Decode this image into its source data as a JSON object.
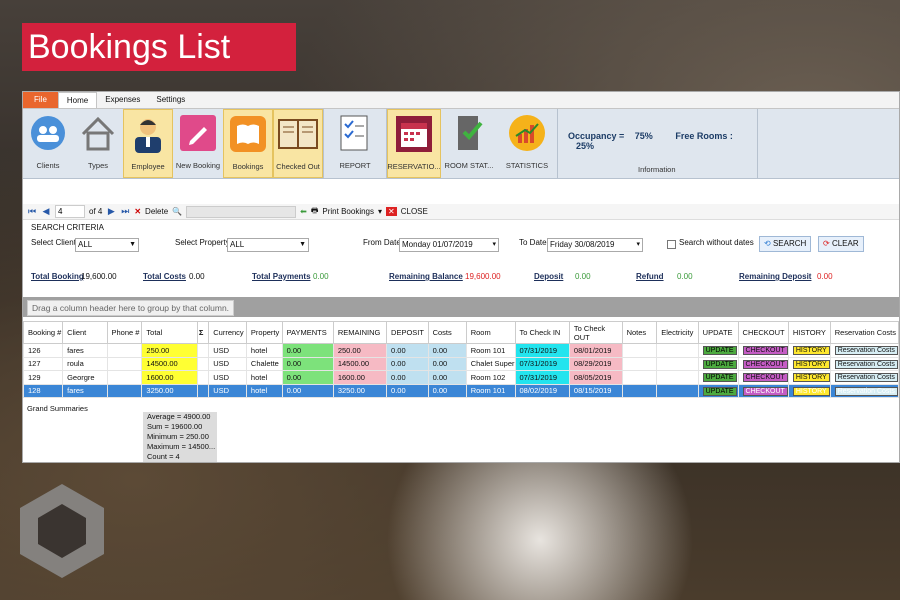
{
  "page_title": "Bookings List",
  "ribbon_tabs": [
    "File",
    "Home",
    "Expenses",
    "Settings"
  ],
  "ribbon_buttons": [
    {
      "label": "Clients",
      "icon": "clients-icon"
    },
    {
      "label": "Types",
      "icon": "home-icon"
    },
    {
      "label": "Employee",
      "icon": "employee-icon"
    },
    {
      "label": "New Booking",
      "icon": "pencil-icon"
    },
    {
      "label": "Bookings",
      "icon": "book-icon"
    },
    {
      "label": "Checked Out",
      "icon": "open-book-icon"
    },
    {
      "label": "REPORT",
      "icon": "report-icon"
    },
    {
      "label": "RESERVATIO...",
      "icon": "calendar-icon"
    },
    {
      "label": "ROOM STAT...",
      "icon": "door-check-icon"
    },
    {
      "label": "STATISTICS",
      "icon": "chart-icon"
    }
  ],
  "info": {
    "occupancy_label": "Occupancy =",
    "occupancy_value": "75%",
    "free_rooms_label": "Free Rooms :",
    "free_rooms_value": "25%",
    "group_label": "Information"
  },
  "navigator": {
    "current": "4",
    "of": "of 4",
    "delete": "Delete",
    "print": "Print Bookings",
    "close": "CLOSE"
  },
  "search": {
    "title": "SEARCH CRITERIA",
    "client_label": "Select Client",
    "client_value": "ALL",
    "property_label": "Select Property",
    "property_value": "ALL",
    "from_label": "From Date:",
    "from_value": "Monday  01/07/2019",
    "to_label": "To Date:",
    "to_value": "Friday  30/08/2019",
    "without_dates": "Search without dates",
    "search_btn": "SEARCH",
    "clear_btn": "CLEAR"
  },
  "totals": {
    "total_booking_label": "Total Booking",
    "total_booking_value": "19,600.00",
    "total_costs_label": "Total Costs",
    "total_costs_value": "0.00",
    "total_payments_label": "Total Payments",
    "total_payments_value": "0.00",
    "remaining_label": "Remaining Balance",
    "remaining_value": "19,600.00",
    "deposit_label": "Deposit",
    "deposit_value": "0.00",
    "refund_label": "Refund",
    "refund_value": "0.00",
    "remaining_deposit_label": "Remaining Deposit",
    "remaining_deposit_value": "0.00"
  },
  "group_hint": "Drag a column header here to group by that column.",
  "columns": [
    "Booking #",
    "Client",
    "Phone #",
    "Total",
    "Σ",
    "Currency",
    "Property",
    "PAYMENTS",
    "REMAINING",
    "DEPOSIT",
    "Costs",
    "Room",
    "To Check IN",
    "To Check OUT",
    "Notes",
    "Electricity",
    "UPDATE",
    "CHECKOUT",
    "HISTORY",
    "Reservation Costs"
  ],
  "rows": [
    {
      "id": "126",
      "client": "fares",
      "phone": "",
      "total": "250.00",
      "currency": "USD",
      "property": "hotel",
      "payments": "0.00",
      "remaining": "250.00",
      "deposit": "0.00",
      "costs": "0.00",
      "room": "Room 101",
      "checkin": "07/31/2019",
      "checkout": "08/01/2019",
      "update": "UPDATE",
      "checkout_btn": "CHECKOUT",
      "history": "HISTORY",
      "res": "Reservation Costs"
    },
    {
      "id": "127",
      "client": "roula",
      "phone": "",
      "total": "14500.00",
      "currency": "USD",
      "property": "Chalette",
      "payments": "0.00",
      "remaining": "14500.00",
      "deposit": "0.00",
      "costs": "0.00",
      "room": "Chalet Super",
      "checkin": "07/31/2019",
      "checkout": "08/29/2019",
      "update": "UPDATE",
      "checkout_btn": "CHECKOUT",
      "history": "HISTORY",
      "res": "Reservation Costs"
    },
    {
      "id": "129",
      "client": "Georgre",
      "phone": "",
      "total": "1600.00",
      "currency": "USD",
      "property": "hotel",
      "payments": "0.00",
      "remaining": "1600.00",
      "deposit": "0.00",
      "costs": "0.00",
      "room": "Room 102",
      "checkin": "07/31/2019",
      "checkout": "08/05/2019",
      "update": "UPDATE",
      "checkout_btn": "CHECKOUT",
      "history": "HISTORY",
      "res": "Reservation Costs"
    },
    {
      "id": "128",
      "client": "fares",
      "phone": "",
      "total": "3250.00",
      "currency": "USD",
      "property": "hotel",
      "payments": "0.00",
      "remaining": "3250.00",
      "deposit": "0.00",
      "costs": "0.00",
      "room": "Room 101",
      "checkin": "08/02/2019",
      "checkout": "08/15/2019",
      "update": "UPDATE",
      "checkout_btn": "CHECKOUT",
      "history": "HISTORY",
      "res": "Reservation Costs"
    }
  ],
  "grand_summaries": "Grand Summaries",
  "summary_lines": [
    "Average = 4900.00",
    "Sum = 19600.00",
    "Minimum = 250.00",
    "Maximum = 14500...",
    "Count = 4"
  ]
}
